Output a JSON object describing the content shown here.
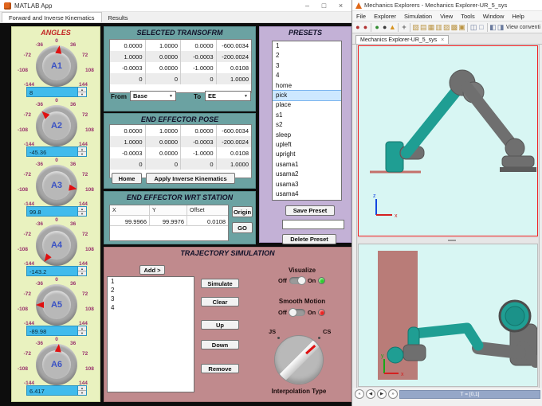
{
  "matlab_app": {
    "title": "MATLAB App",
    "window_controls": {
      "minimize": "–",
      "maximize": "□",
      "close": "×"
    },
    "tabs": [
      {
        "label": "Forward and Inverse Kinematics"
      },
      {
        "label": "Results"
      }
    ],
    "angles": {
      "title": "ANGLES",
      "ticks": [
        "0",
        "36",
        "72",
        "108",
        "144",
        "-36",
        "-72",
        "-108",
        "-144"
      ],
      "knobs": [
        {
          "label": "A1",
          "value": "8",
          "angle": 8
        },
        {
          "label": "A2",
          "value": "-45.36",
          "angle": -45.36
        },
        {
          "label": "A3",
          "value": "99.8",
          "angle": 99.8
        },
        {
          "label": "A4",
          "value": "-143.2",
          "angle": -143.2
        },
        {
          "label": "A5",
          "value": "-89.98",
          "angle": -89.98
        },
        {
          "label": "A6",
          "value": "6.417",
          "angle": 6.417
        }
      ]
    },
    "selected_transform": {
      "title": "SELECTED TRANSOFRM",
      "matrix": [
        [
          "0.0000",
          "1.0000",
          "0.0000",
          "-600.0034"
        ],
        [
          "1.0000",
          "0.0000",
          "-0.0003",
          "-200.0024"
        ],
        [
          "-0.0003",
          "0.0000",
          "-1.0000",
          "0.0108"
        ],
        [
          "0",
          "0",
          "0",
          "1.0000"
        ]
      ],
      "from_label": "From",
      "from_value": "Base",
      "to_label": "To",
      "to_value": "EE"
    },
    "end_effector_pose": {
      "title": "END EFFECTOR POSE",
      "matrix": [
        [
          "0.0000",
          "1.0000",
          "0.0000",
          "-600.0034"
        ],
        [
          "1.0000",
          "0.0000",
          "-0.0003",
          "-200.0024"
        ],
        [
          "-0.0003",
          "0.0000",
          "-1.0000",
          "0.0108"
        ],
        [
          "0",
          "0",
          "0",
          "1.0000"
        ]
      ],
      "home_button": "Home",
      "apply_ik_button": "Apply Inverse Kinematics"
    },
    "end_effector_wrt_station": {
      "title": "END EFFECTOR WRT STATION",
      "headers": [
        "X",
        "Y",
        "Offset"
      ],
      "values": [
        "99.9966",
        "99.9976",
        "0.0108"
      ],
      "origin_button": "Origin",
      "go_button": "GO"
    },
    "presets": {
      "title": "PRESETS",
      "items": [
        "1",
        "2",
        "3",
        "4",
        "home",
        "pick",
        "place",
        "s1",
        "s2",
        "sleep",
        "upleft",
        "upright",
        "usama1",
        "usama2",
        "usama3",
        "usama4"
      ],
      "selected_item": "pick",
      "selected_index": 5,
      "save_button": "Save Preset",
      "field_value": "",
      "delete_button": "Delete Preset"
    },
    "trajectory": {
      "title": "TRAJECTORY SIMULATION",
      "add_button": "Add >",
      "items": [
        "1",
        "2",
        "3",
        "4"
      ],
      "simulate_button": "Simulate",
      "clear_button": "Clear",
      "up_button": "Up",
      "down_button": "Down",
      "remove_button": "Remove",
      "visualize": {
        "label": "Visualize",
        "off": "Off",
        "on": "On",
        "state": "on",
        "lamp_color": "#2ecc2e"
      },
      "smooth_motion": {
        "label": "Smooth Motion",
        "off": "Off",
        "on": "On",
        "state": "off",
        "lamp_color": "#e82222"
      },
      "interp": {
        "left": "JS",
        "right": "CS",
        "label": "Interpolation Type",
        "selected": "CS",
        "angle": 48
      }
    }
  },
  "mechanics_explorer": {
    "title": "Mechanics Explorers - Mechanics Explorer-UR_5_sys",
    "menus": [
      "File",
      "Explorer",
      "Simulation",
      "View",
      "Tools",
      "Window",
      "Help"
    ],
    "toolbar": {
      "view_convention_label": "View conventi",
      "icons": [
        {
          "name": "camera-red-icon",
          "glyph": "●",
          "color": "#b03030"
        },
        {
          "name": "camera2-red-icon",
          "glyph": "●",
          "color": "#b03030"
        },
        {
          "name": "video-export-icon",
          "glyph": "●",
          "color": "#2e8b2e"
        },
        {
          "name": "sphere-icon",
          "glyph": "●",
          "color": "#3a3a3a"
        },
        {
          "name": "cone-icon",
          "glyph": "▲",
          "color": "#d79422"
        },
        {
          "name": "fit-to-view-icon",
          "glyph": "+",
          "color": "#666666"
        },
        {
          "name": "iso-view-icon",
          "glyph": "▧",
          "color": "#bb9442"
        },
        {
          "name": "front-view-icon",
          "glyph": "▤",
          "color": "#bb9442"
        },
        {
          "name": "back-view-icon",
          "glyph": "▦",
          "color": "#bb9442"
        },
        {
          "name": "top-view-icon",
          "glyph": "▥",
          "color": "#bb9442"
        },
        {
          "name": "bottom-view-icon",
          "glyph": "▨",
          "color": "#bb9442"
        },
        {
          "name": "left-view-icon",
          "glyph": "▩",
          "color": "#bb9442"
        },
        {
          "name": "right-view-icon",
          "glyph": "▣",
          "color": "#bb9442"
        },
        {
          "name": "split-view-icon",
          "glyph": "◫",
          "color": "#6b7b9e"
        },
        {
          "name": "single-view-icon",
          "glyph": "□",
          "color": "#6b7b9e"
        },
        {
          "name": "prev-viewpoint-icon",
          "glyph": "◧",
          "color": "#6b7b9e"
        },
        {
          "name": "next-viewpoint-icon",
          "glyph": "◨",
          "color": "#6b7b9e"
        }
      ]
    },
    "tab": {
      "label": "Mechanics Explorer-UR_5_sys",
      "close": "×"
    },
    "top_view_axes": {
      "vertical": "z",
      "horizontal": "x"
    },
    "bottom_view_axes": {
      "vertical": "y",
      "horizontal": "x"
    },
    "playback": {
      "buttons": [
        {
          "name": "rewind-button",
          "glyph": "«"
        },
        {
          "name": "step-back-button",
          "glyph": "◀"
        },
        {
          "name": "play-button",
          "glyph": "▶"
        },
        {
          "name": "step-forward-button",
          "glyph": "»"
        }
      ],
      "time_label": "T = [0,1]"
    },
    "colors": {
      "viewport_bg": "#d8f6f3",
      "selection_border": "#f22323",
      "robot_teal": "#1f9e93",
      "robot_gray": "#6f6f6f",
      "wall": "#b97c78"
    }
  }
}
